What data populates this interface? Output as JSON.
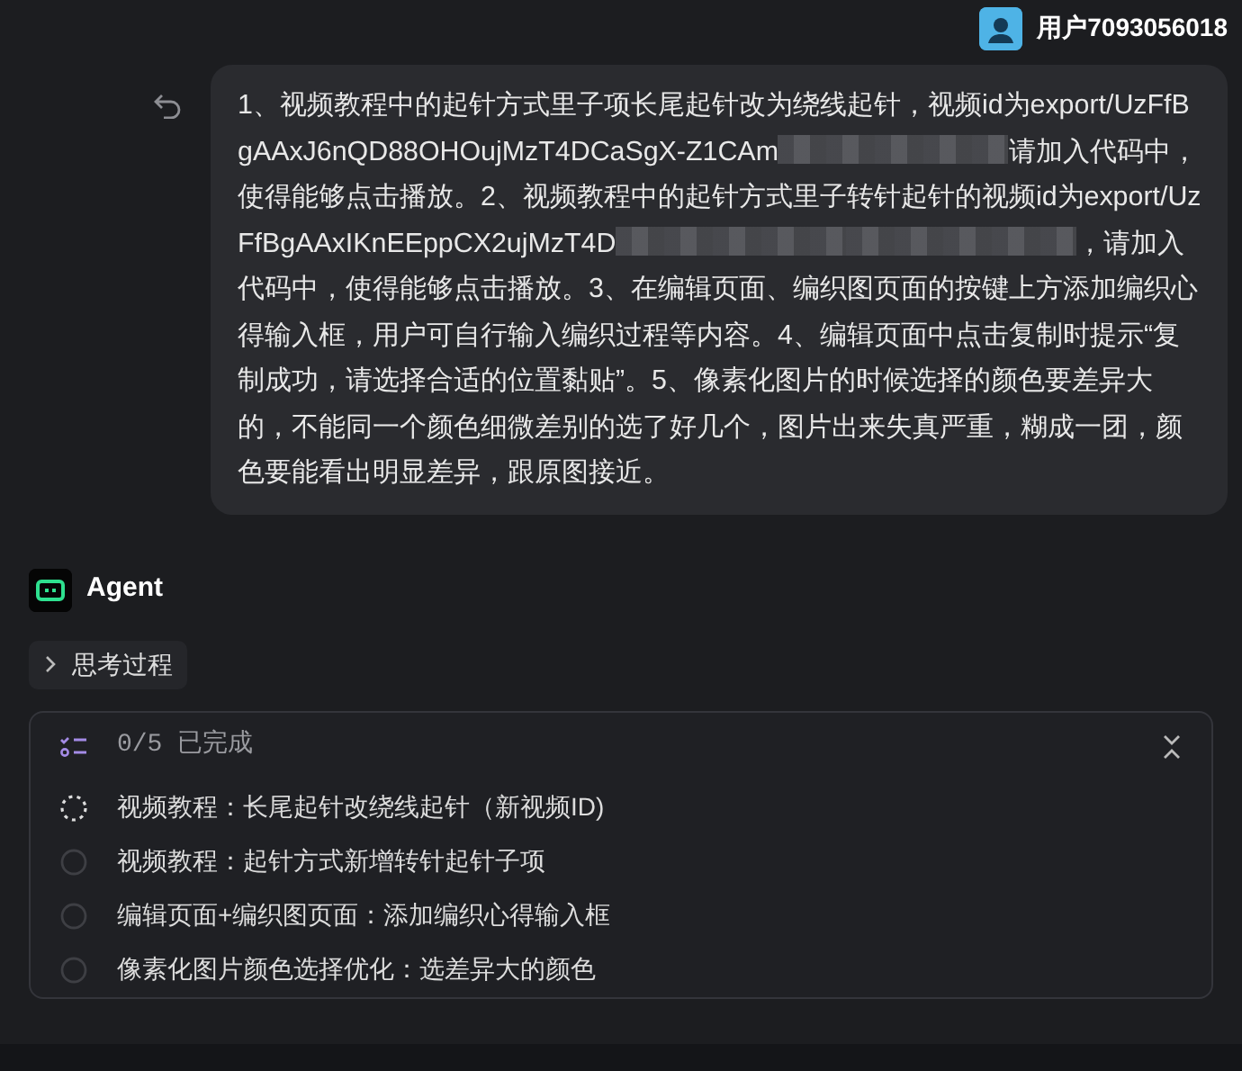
{
  "user": {
    "name": "用户7093056018"
  },
  "message": {
    "segments": [
      {
        "kind": "text",
        "text": "1、视频教程中的起针方式里子项长尾起针改为绕线起针，视频id为export/UzFfBgAAxJ6nQD88OHOujMzT4DCaSgX-Z1CAm"
      },
      {
        "kind": "blurred"
      },
      {
        "kind": "text",
        "text": "请加入代码中，使得能够点击播放。2、视频教程中的起针方式里子转针起针的视频id为export/UzFfBgAAxIKnEEppCX2ujMzT4D"
      },
      {
        "kind": "blurred"
      },
      {
        "kind": "blurred"
      },
      {
        "kind": "text",
        "text": "，请加入代码中，使得能够点击播放。3、在编辑页面、编织图页面的按键上方添加编织心得输入框，用户可自行输入编织过程等内容。4、编辑页面中点击复制时提示“复制成功，请选择合适的位置黏贴”。5、像素化图片的时候选择的颜色要差异大的，不能同一个颜色细微差别的选了好几个，图片出来失真严重，糊成一团，颜色要能看出明显差异，跟原图接近。"
      }
    ]
  },
  "agent": {
    "name": "Agent"
  },
  "thinking": {
    "label": "思考过程",
    "expanded": false
  },
  "tasks": {
    "summary": "0/5 已完成",
    "items": [
      {
        "text": "视频教程：长尾起针改绕线起针（新视频ID)",
        "in_progress": true
      },
      {
        "text": "视频教程：起针方式新增转针起针子项",
        "in_progress": false
      },
      {
        "text": "编辑页面+编织图页面：添加编织心得输入框",
        "in_progress": false
      },
      {
        "text": "像素化图片颜色选择优化：选差异大的颜色",
        "in_progress": false
      }
    ]
  }
}
